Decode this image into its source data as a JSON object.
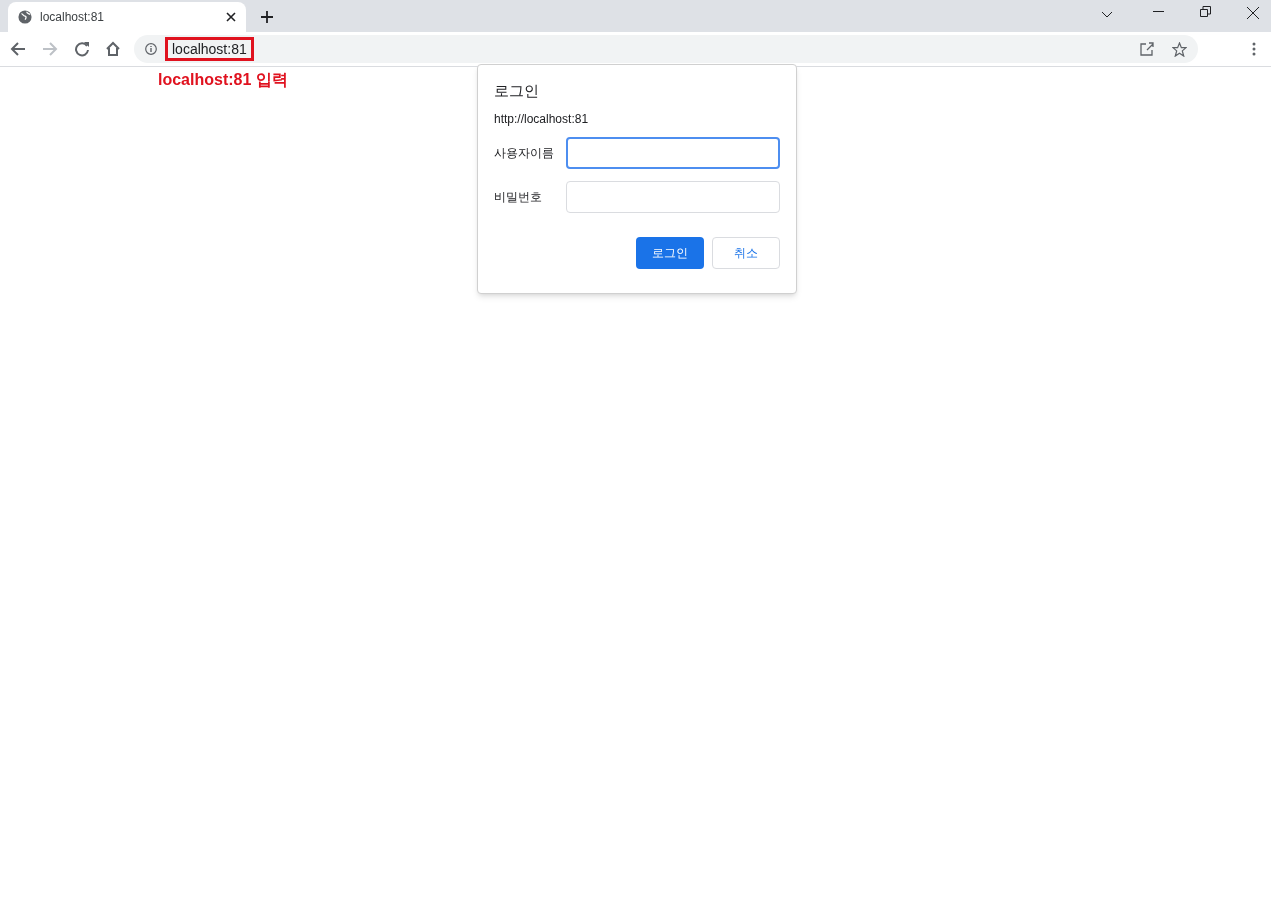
{
  "tab": {
    "title": "localhost:81",
    "selected": true
  },
  "address_bar": {
    "url": "localhost:81"
  },
  "annotation": {
    "label": "localhost:81 입력"
  },
  "dialog": {
    "title": "로그인",
    "origin": "http://localhost:81",
    "fields": [
      {
        "label": "사용자이름",
        "focused": true
      },
      {
        "label": "비밀번호",
        "focused": false
      }
    ],
    "buttons": [
      {
        "label": "로그인",
        "kind": "primary"
      },
      {
        "label": "취소",
        "kind": "secondary"
      }
    ]
  }
}
